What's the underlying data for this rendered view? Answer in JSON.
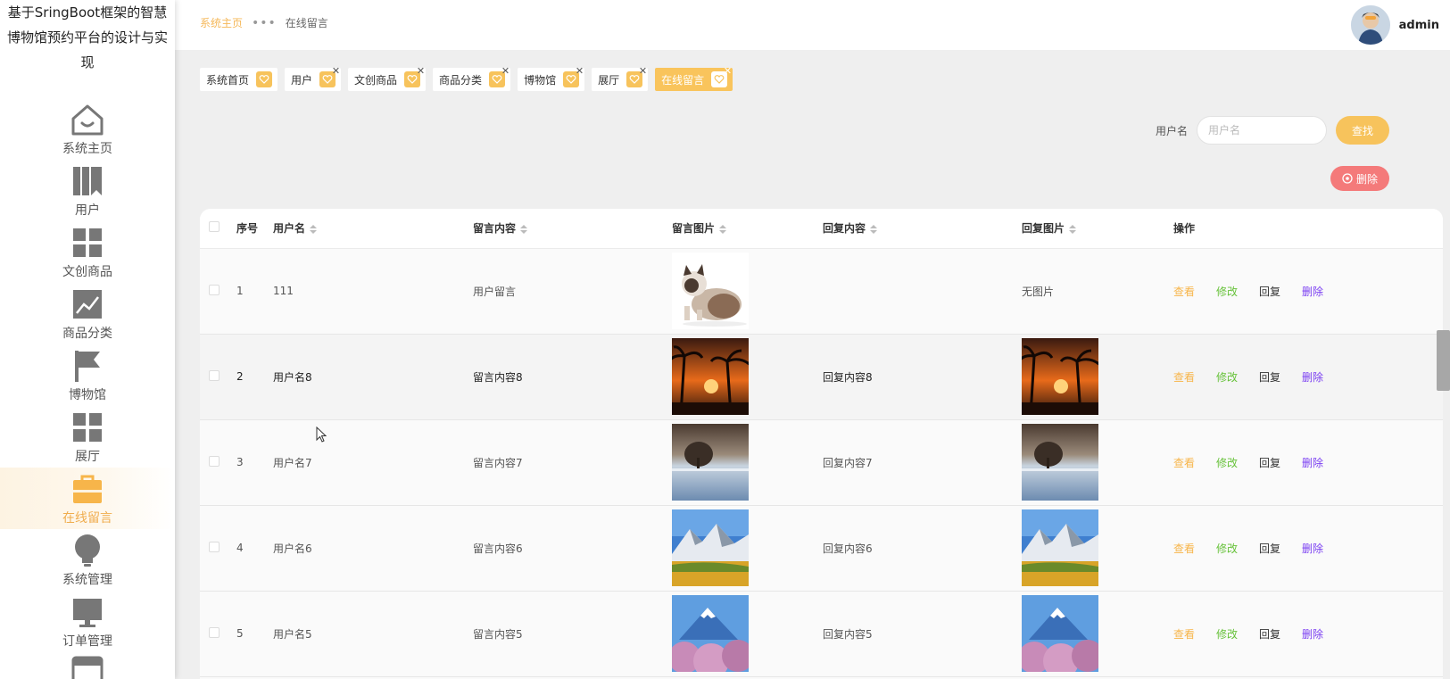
{
  "app": {
    "title": "基于SringBoot框架的智慧博物馆预约平台的设计与实现"
  },
  "sidebar": {
    "items": [
      {
        "label": "系统主页",
        "icon": "home-icon"
      },
      {
        "label": "用户",
        "icon": "book-icon"
      },
      {
        "label": "文创商品",
        "icon": "grid-icon"
      },
      {
        "label": "商品分类",
        "icon": "trend-chart-icon"
      },
      {
        "label": "博物馆",
        "icon": "flag-icon"
      },
      {
        "label": "展厅",
        "icon": "grid-icon"
      },
      {
        "label": "在线留言",
        "icon": "briefcase-icon",
        "active": true
      },
      {
        "label": "系统管理",
        "icon": "bulb-icon"
      },
      {
        "label": "订单管理",
        "icon": "monitor-icon"
      },
      {
        "label": "",
        "icon": "window-icon"
      }
    ]
  },
  "header": {
    "breadcrumb_home": "系统主页",
    "breadcrumb_current": "在线留言",
    "username": "admin"
  },
  "tabs": [
    {
      "label": "系统首页",
      "active": false
    },
    {
      "label": "用户",
      "active": false
    },
    {
      "label": "文创商品",
      "active": false
    },
    {
      "label": "商品分类",
      "active": false
    },
    {
      "label": "博物馆",
      "active": false
    },
    {
      "label": "展厅",
      "active": false
    },
    {
      "label": "在线留言",
      "active": true
    }
  ],
  "search": {
    "label": "用户名",
    "placeholder": "用户名",
    "button": "查找"
  },
  "delete_button": "删除",
  "table": {
    "columns": [
      "序号",
      "用户名",
      "留言内容",
      "留言图片",
      "回复内容",
      "回复图片",
      "操作"
    ],
    "actions": {
      "view": "查看",
      "edit": "修改",
      "reply": "回复",
      "delete": "删除"
    },
    "rows": [
      {
        "index": "1",
        "username": "111",
        "content": "用户留言",
        "image": "cat",
        "reply": "",
        "reply_image": "",
        "reply_image_text": "无图片"
      },
      {
        "index": "2",
        "username": "用户名8",
        "content": "留言内容8",
        "image": "sunset",
        "reply": "回复内容8",
        "reply_image": "sunset",
        "reply_image_text": ""
      },
      {
        "index": "3",
        "username": "用户名7",
        "content": "留言内容7",
        "image": "lake",
        "reply": "回复内容7",
        "reply_image": "lake",
        "reply_image_text": ""
      },
      {
        "index": "4",
        "username": "用户名6",
        "content": "留言内容6",
        "image": "mountain",
        "reply": "回复内容6",
        "reply_image": "mountain",
        "reply_image_text": ""
      },
      {
        "index": "5",
        "username": "用户名5",
        "content": "留言内容5",
        "image": "fuji",
        "reply": "回复内容5",
        "reply_image": "fuji",
        "reply_image_text": ""
      }
    ]
  },
  "colors": {
    "accent": "#f7c35c",
    "danger": "#f47a7a",
    "edit": "#67c23a",
    "delete_link": "#7b3ff2"
  }
}
